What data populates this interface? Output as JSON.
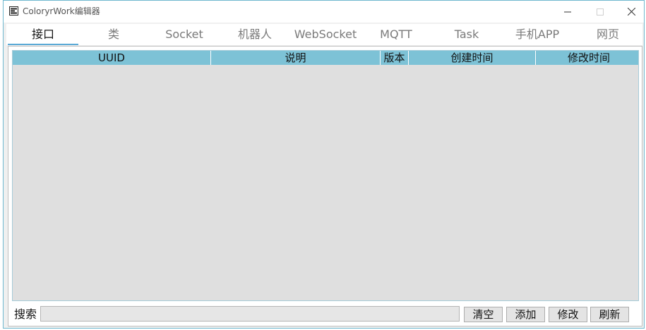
{
  "window": {
    "title": "ColoryrWork编辑器"
  },
  "tabs": [
    {
      "label": "接口"
    },
    {
      "label": "类"
    },
    {
      "label": "Socket"
    },
    {
      "label": "机器人"
    },
    {
      "label": "WebSocket"
    },
    {
      "label": "MQTT"
    },
    {
      "label": "Task"
    },
    {
      "label": "手机APP"
    },
    {
      "label": "网页"
    }
  ],
  "active_tab": "接口",
  "table": {
    "columns": [
      "UUID",
      "说明",
      "版本",
      "创建时间",
      "修改时间"
    ],
    "rows": []
  },
  "search": {
    "label": "搜索",
    "value": ""
  },
  "buttons": {
    "clear": "清空",
    "add": "添加",
    "edit": "修改",
    "refresh": "刷新"
  },
  "colors": {
    "header": "#7dc2d6",
    "tab_underline": "#5aa9d6",
    "grid_bg": "#dfdfdf"
  }
}
